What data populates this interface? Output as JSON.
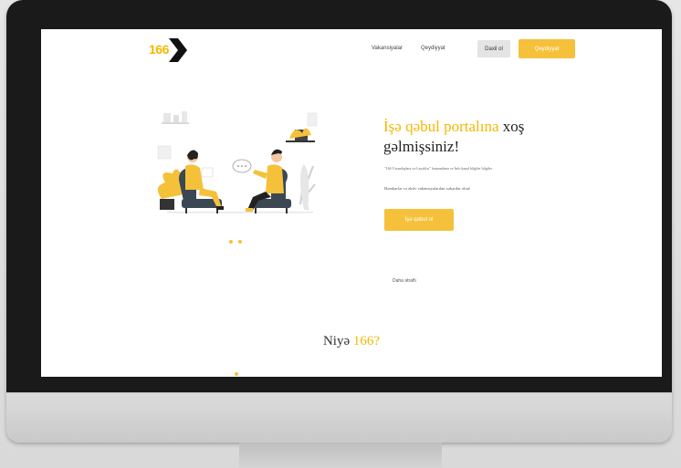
{
  "header": {
    "logo_text": "166",
    "nav_vacancies": "Vakansiyalar",
    "nav_register": "Qeydiyyat",
    "nav_login": "Daxil ol",
    "nav_cta": "Qeydiyyat"
  },
  "hero": {
    "title_accent": "İşə qəbul portalına",
    "title_rest": " xoş",
    "title_line2": "gəlmişsiniz!",
    "subtitle": "\"166 Vətəndaşlara və Layəhlər\" hamamlıma ve İnfo kanal bilgiler bilgiler",
    "subtitle2": "Həmkarlar və aktiv vakansiyalardan xəbərdar olun!",
    "button_label": "İşə qəbul ol"
  },
  "scroll_link": "Daha ətraflı",
  "section": {
    "title_prefix": "Niyə ",
    "title_accent": "166?"
  },
  "colors": {
    "accent": "#f5b800",
    "button": "#f5c13a",
    "bezel": "#1a1a1a"
  }
}
